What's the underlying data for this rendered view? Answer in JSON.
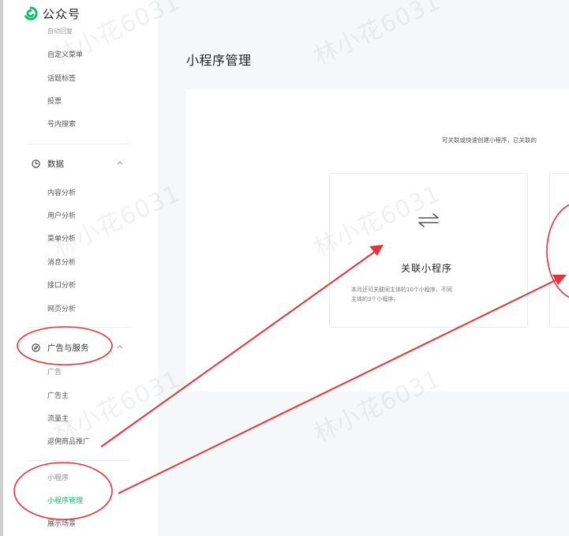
{
  "app": {
    "name": "公众号",
    "brand_color": "#07c160"
  },
  "sidebar": {
    "top_items": [
      "自动回复",
      "自定义菜单",
      "话题标签",
      "投票",
      "号内搜索"
    ],
    "data_section": {
      "label": "数据",
      "icon": "clock-icon",
      "items": [
        "内容分析",
        "用户分析",
        "菜单分析",
        "消息分析",
        "接口分析",
        "网页分析"
      ]
    },
    "ads_section": {
      "label": "广告与服务",
      "icon": "compass-icon",
      "items": [
        "广告",
        "广告主",
        "流量主",
        "返佣商品推广"
      ]
    },
    "mini_section": {
      "items": [
        "小程序",
        "小程序管理",
        "展示场景"
      ],
      "active": "小程序管理"
    }
  },
  "main": {
    "title": "小程序管理",
    "description": "可关联或快速创建小程序，已关联的",
    "card": {
      "icon": "swap-arrows-icon",
      "title": "关联小程序",
      "subtitle_line1": "本月还可关联同主体的10个小程序，不同",
      "subtitle_line2": "主体的3个小程序。"
    }
  },
  "watermark": "林小花6031",
  "annotation_color": "#e8323a"
}
